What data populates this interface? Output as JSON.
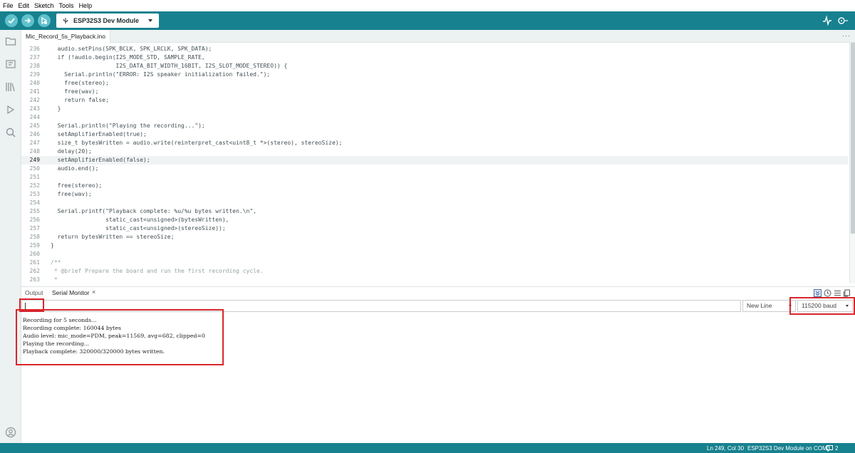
{
  "menu": {
    "items": [
      "File",
      "Edit",
      "Sketch",
      "Tools",
      "Help"
    ]
  },
  "toolbar": {
    "board": "ESP32S3 Dev Module",
    "accent": "#17818f"
  },
  "tabs": {
    "file": "Mic_Record_5s_Playback.ino"
  },
  "editor": {
    "active_line": 249,
    "lines": [
      {
        "n": "236",
        "text": "  audio.setPins(SPK_BCLK, SPK_LRCLK, SPK_DATA);"
      },
      {
        "n": "237",
        "text": "  if (!audio.begin(I2S_MODE_STD, SAMPLE_RATE,"
      },
      {
        "n": "238",
        "text": "                   I2S_DATA_BIT_WIDTH_16BIT, I2S_SLOT_MODE_STEREO)) {"
      },
      {
        "n": "239",
        "text": "    Serial.println(\"ERROR: I2S speaker initialization failed.\");"
      },
      {
        "n": "240",
        "text": "    free(stereo);"
      },
      {
        "n": "241",
        "text": "    free(wav);"
      },
      {
        "n": "242",
        "text": "    return false;"
      },
      {
        "n": "243",
        "text": "  }"
      },
      {
        "n": "244",
        "text": ""
      },
      {
        "n": "245",
        "text": "  Serial.println(\"Playing the recording...\");"
      },
      {
        "n": "246",
        "text": "  setAmplifierEnabled(true);"
      },
      {
        "n": "247",
        "text": "  size_t bytesWritten = audio.write(reinterpret_cast<uint8_t *>(stereo), stereoSize);"
      },
      {
        "n": "248",
        "text": "  delay(20);"
      },
      {
        "n": "249",
        "text": "  setAmplifierEnabled(false);"
      },
      {
        "n": "250",
        "text": "  audio.end();"
      },
      {
        "n": "251",
        "text": ""
      },
      {
        "n": "252",
        "text": "  free(stereo);"
      },
      {
        "n": "253",
        "text": "  free(wav);"
      },
      {
        "n": "254",
        "text": ""
      },
      {
        "n": "255",
        "text": "  Serial.printf(\"Playback complete: %u/%u bytes written.\\n\","
      },
      {
        "n": "256",
        "text": "                static_cast<unsigned>(bytesWritten),"
      },
      {
        "n": "257",
        "text": "                static_cast<unsigned>(stereoSize));"
      },
      {
        "n": "258",
        "text": "  return bytesWritten == stereoSize;"
      },
      {
        "n": "259",
        "text": "}"
      },
      {
        "n": "260",
        "text": ""
      },
      {
        "n": "261",
        "text": "/**"
      },
      {
        "n": "262",
        "text": " * @brief Prepare the board and run the first recording cycle."
      },
      {
        "n": "263",
        "text": " *"
      }
    ]
  },
  "panel": {
    "tab_output": "Output",
    "tab_serial": "Serial Monitor",
    "tab_close": "×",
    "input_value": "",
    "line_ending": "New Line",
    "baud": "115200 baud",
    "output_lines": [
      "Recording for 5 seconds...",
      "Recording complete: 160044 bytes",
      "Audio level: mic_mode=PDM, peak=11569, avg=682, clipped=0",
      "Playing the recording...",
      "Playback complete: 320000/320000 bytes written."
    ]
  },
  "status": {
    "position": "Ln 249, Col 30",
    "board_port": "ESP32S3 Dev Module on COM3",
    "notifications": "2"
  }
}
